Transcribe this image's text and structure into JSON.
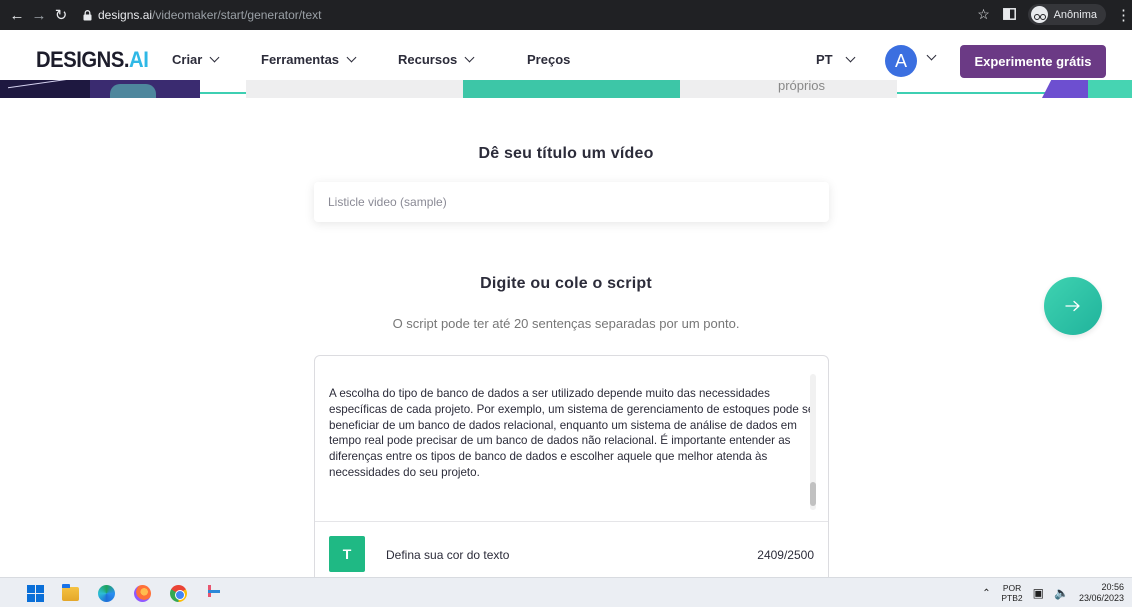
{
  "browser": {
    "url_host": "designs.ai",
    "url_path": "/videomaker/start/generator/text",
    "profile_label": "Anônima"
  },
  "header": {
    "logo_main": "DESIGNS.",
    "logo_ai": "AI",
    "nav": [
      {
        "label": "Criar"
      },
      {
        "label": "Ferramentas"
      },
      {
        "label": "Recursos"
      },
      {
        "label": "Preços"
      }
    ],
    "language": "PT",
    "avatar_letter": "A",
    "cta_label": "Experimente grátis"
  },
  "hero": {
    "partial_text": "próprios"
  },
  "main": {
    "video_title_heading": "Dê seu título um vídeo",
    "video_title_value": "Listicle video (sample)",
    "script_heading": "Digite ou cole o script",
    "script_subtitle": "O script pode ter até 20 sentenças separadas por um ponto.",
    "script_text": "A escolha do tipo de banco de dados a ser utilizado depende muito das necessidades específicas de cada projeto. Por exemplo, um sistema de gerenciamento de estoques pode se beneficiar de um banco de dados relacional, enquanto um sistema de análise de dados em tempo real pode precisar de um banco de dados não relacional. É importante entender as diferenças entre os tipos de banco de dados e escolher aquele que melhor atenda às necessidades do seu projeto.",
    "text_color_letter": "T",
    "text_color_label": "Defina sua cor do texto",
    "char_count": "2409/2500",
    "text_color_hex": "#1fb984"
  },
  "taskbar": {
    "lang_line1": "POR",
    "lang_line2": "PTB2",
    "time": "20:56",
    "date": "23/06/2023"
  },
  "colors": {
    "accent_teal": "#3ecfb2",
    "cta_purple": "#6b3a85",
    "avatar_blue": "#3b6fe0"
  }
}
